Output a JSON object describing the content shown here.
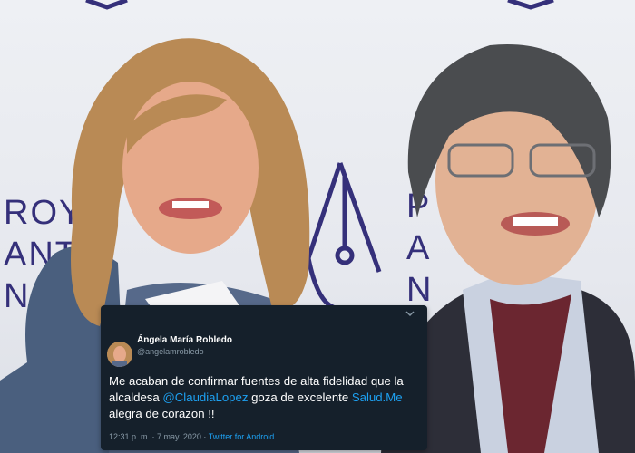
{
  "photo": {
    "brand_left": "ROY\nANT\nN",
    "brand_right": "P\nA\nN"
  },
  "tweet": {
    "name": "Ángela María Robledo",
    "handle": "@angelamrobledo",
    "text_parts": {
      "p1": "Me acaban de confirmar fuentes de alta fidelidad  que la alcaldesa ",
      "mention": "@ClaudiaLopez",
      "p2": " goza de excelente ",
      "link": "Salud.Me",
      "p3": " alegra de corazon !!"
    },
    "timestamp": "12:31 p. m. · 7 may. 2020 · ",
    "source": "Twitter for Android"
  },
  "colors": {
    "tweet_bg": "#15202b",
    "link": "#1da1f2",
    "muted": "#8899a6",
    "brand": "#35307a"
  }
}
